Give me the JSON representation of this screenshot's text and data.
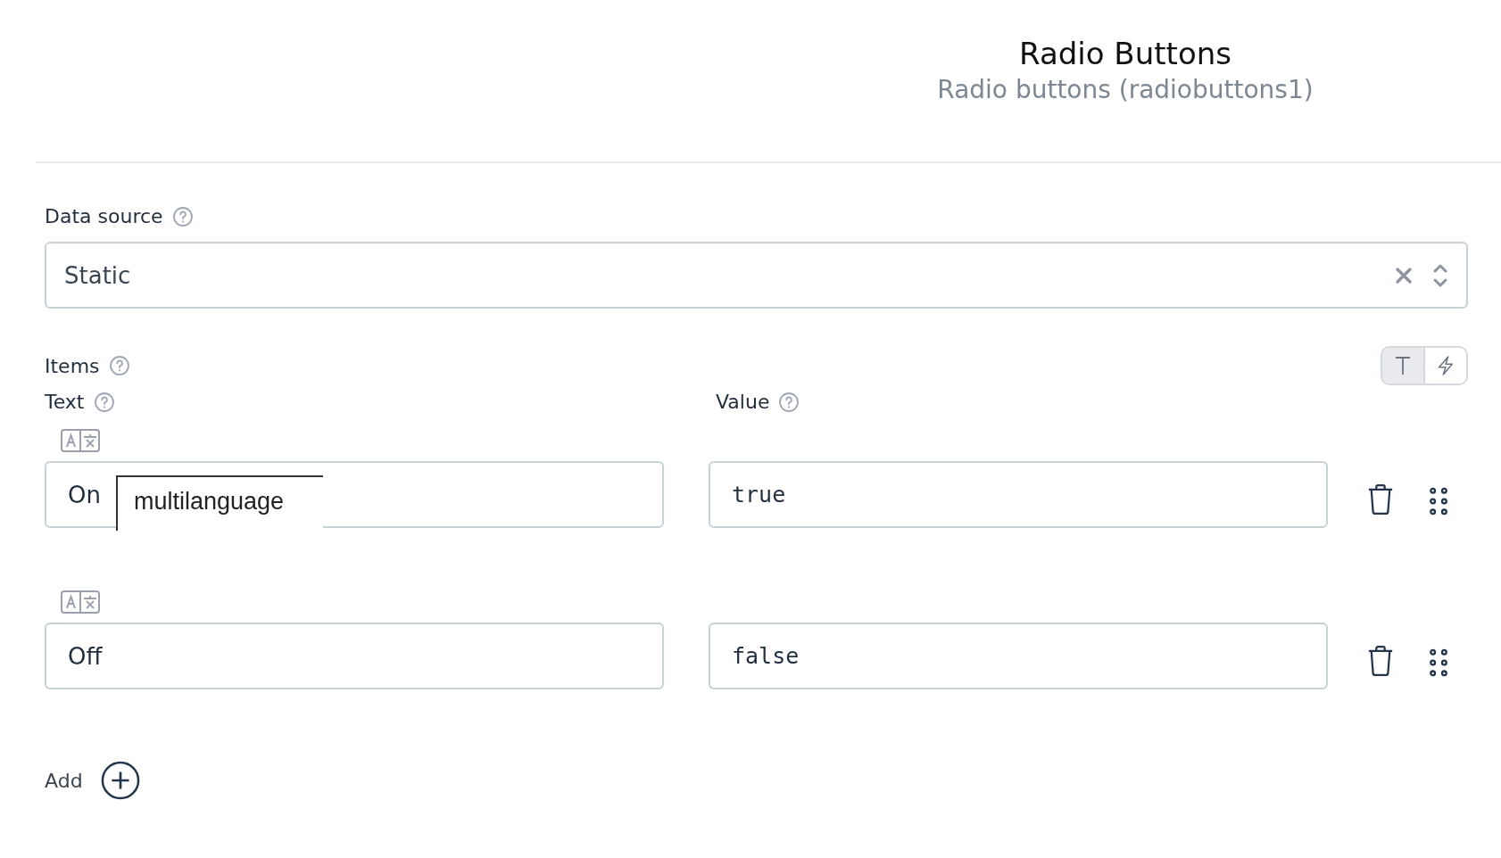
{
  "header": {
    "title": "Radio Buttons",
    "subtitle": "Radio buttons (radiobuttons1)"
  },
  "data_source": {
    "label": "Data source",
    "value": "Static"
  },
  "items": {
    "label": "Items",
    "mode_toggle": [
      {
        "kind": "text",
        "selected": true
      },
      {
        "kind": "dynamic",
        "selected": false
      }
    ],
    "columns": [
      "Text",
      "Value"
    ],
    "rows": [
      {
        "text": "On",
        "value": "true",
        "tooltip": "multilanguage"
      },
      {
        "text": "Off",
        "value": "false"
      }
    ]
  },
  "add_button": {
    "label": "Add"
  }
}
